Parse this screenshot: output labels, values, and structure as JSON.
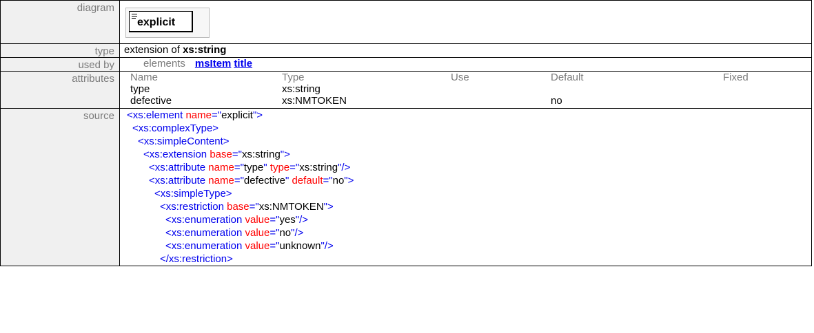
{
  "rows": {
    "diagram": {
      "label": "diagram",
      "element_name": "explicit"
    },
    "type": {
      "label": "type",
      "prefix": "extension of ",
      "base": "xs:string"
    },
    "used_by": {
      "label": "used by",
      "lead": "elements",
      "links": [
        "msItem",
        "title"
      ]
    },
    "attributes": {
      "label": "attributes",
      "headers": [
        "Name",
        "Type",
        "Use",
        "Default",
        "Fixed"
      ],
      "rows": [
        [
          "type",
          "xs:string",
          "",
          "",
          ""
        ],
        [
          "defective",
          "xs:NMTOKEN",
          "",
          "no",
          ""
        ]
      ]
    },
    "source": {
      "label": "source",
      "lines": [
        {
          "indent": 0,
          "tokens": [
            {
              "t": "tag",
              "s": "<xs:element "
            },
            {
              "t": "attr",
              "s": "name"
            },
            {
              "t": "tag",
              "s": "=\""
            },
            {
              "t": "val",
              "s": "explicit"
            },
            {
              "t": "tag",
              "s": "\">"
            }
          ]
        },
        {
          "indent": 1,
          "tokens": [
            {
              "t": "tag",
              "s": "<xs:complexType>"
            }
          ]
        },
        {
          "indent": 2,
          "tokens": [
            {
              "t": "tag",
              "s": "<xs:simpleContent>"
            }
          ]
        },
        {
          "indent": 3,
          "tokens": [
            {
              "t": "tag",
              "s": "<xs:extension "
            },
            {
              "t": "attr",
              "s": "base"
            },
            {
              "t": "tag",
              "s": "=\""
            },
            {
              "t": "val",
              "s": "xs:string"
            },
            {
              "t": "tag",
              "s": "\">"
            }
          ]
        },
        {
          "indent": 4,
          "tokens": [
            {
              "t": "tag",
              "s": "<xs:attribute "
            },
            {
              "t": "attr",
              "s": "name"
            },
            {
              "t": "tag",
              "s": "=\""
            },
            {
              "t": "val",
              "s": "type"
            },
            {
              "t": "tag",
              "s": "\" "
            },
            {
              "t": "attr",
              "s": "type"
            },
            {
              "t": "tag",
              "s": "=\""
            },
            {
              "t": "val",
              "s": "xs:string"
            },
            {
              "t": "tag",
              "s": "\"/>"
            }
          ]
        },
        {
          "indent": 4,
          "tokens": [
            {
              "t": "tag",
              "s": "<xs:attribute "
            },
            {
              "t": "attr",
              "s": "name"
            },
            {
              "t": "tag",
              "s": "=\""
            },
            {
              "t": "val",
              "s": "defective"
            },
            {
              "t": "tag",
              "s": "\" "
            },
            {
              "t": "attr",
              "s": "default"
            },
            {
              "t": "tag",
              "s": "=\""
            },
            {
              "t": "val",
              "s": "no"
            },
            {
              "t": "tag",
              "s": "\">"
            }
          ]
        },
        {
          "indent": 5,
          "tokens": [
            {
              "t": "tag",
              "s": "<xs:simpleType>"
            }
          ]
        },
        {
          "indent": 6,
          "tokens": [
            {
              "t": "tag",
              "s": "<xs:restriction "
            },
            {
              "t": "attr",
              "s": "base"
            },
            {
              "t": "tag",
              "s": "=\""
            },
            {
              "t": "val",
              "s": "xs:NMTOKEN"
            },
            {
              "t": "tag",
              "s": "\">"
            }
          ]
        },
        {
          "indent": 7,
          "tokens": [
            {
              "t": "tag",
              "s": "<xs:enumeration "
            },
            {
              "t": "attr",
              "s": "value"
            },
            {
              "t": "tag",
              "s": "=\""
            },
            {
              "t": "val",
              "s": "yes"
            },
            {
              "t": "tag",
              "s": "\"/>"
            }
          ]
        },
        {
          "indent": 7,
          "tokens": [
            {
              "t": "tag",
              "s": "<xs:enumeration "
            },
            {
              "t": "attr",
              "s": "value"
            },
            {
              "t": "tag",
              "s": "=\""
            },
            {
              "t": "val",
              "s": "no"
            },
            {
              "t": "tag",
              "s": "\"/>"
            }
          ]
        },
        {
          "indent": 7,
          "tokens": [
            {
              "t": "tag",
              "s": "<xs:enumeration "
            },
            {
              "t": "attr",
              "s": "value"
            },
            {
              "t": "tag",
              "s": "=\""
            },
            {
              "t": "val",
              "s": "unknown"
            },
            {
              "t": "tag",
              "s": "\"/>"
            }
          ]
        },
        {
          "indent": 6,
          "tokens": [
            {
              "t": "tag",
              "s": "</xs:restriction>"
            }
          ]
        }
      ]
    }
  },
  "colors": {
    "tag": "#0000ee",
    "attr": "#ff0000",
    "value": "#000000",
    "label": "#7a7a7a",
    "label_bg": "#f0f0f0"
  }
}
